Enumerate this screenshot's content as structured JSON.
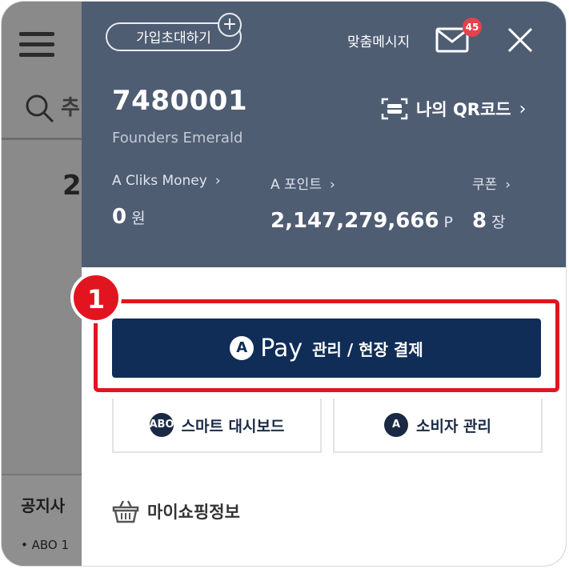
{
  "background": {
    "search_hint": "추",
    "number_fragment": "2",
    "notice_title": "공지사",
    "notice_item": "• ABO 1"
  },
  "header": {
    "invite_label": "가입초대하기",
    "message_label": "맞춤메시지",
    "mail_badge_count": "45",
    "member_number": "7480001",
    "member_grade": "Founders Emerald",
    "qr_label": "나의 QR코드"
  },
  "stats": [
    {
      "label": "A Cliks Money",
      "value": "0",
      "unit": "원"
    },
    {
      "label": "A 포인트",
      "value": "2,147,279,666",
      "unit": "P"
    },
    {
      "label": "쿠폰",
      "value": "8",
      "unit": "장"
    }
  ],
  "annotation": {
    "step_number": "1",
    "highlight_color": "#e2141f"
  },
  "pay_button": {
    "icon_letter": "A",
    "word": "Pay",
    "sub_label": "관리 / 현장 결제"
  },
  "sub_buttons": [
    {
      "label": "스마트 대시보드",
      "icon": "ABO"
    },
    {
      "label": "소비자 관리",
      "icon": "A"
    }
  ],
  "shopping_label": "마이쇼핑정보",
  "colors": {
    "header_bg": "#4f5d73",
    "pay_bg": "#0f2d56",
    "badge_red": "#e5414a"
  }
}
